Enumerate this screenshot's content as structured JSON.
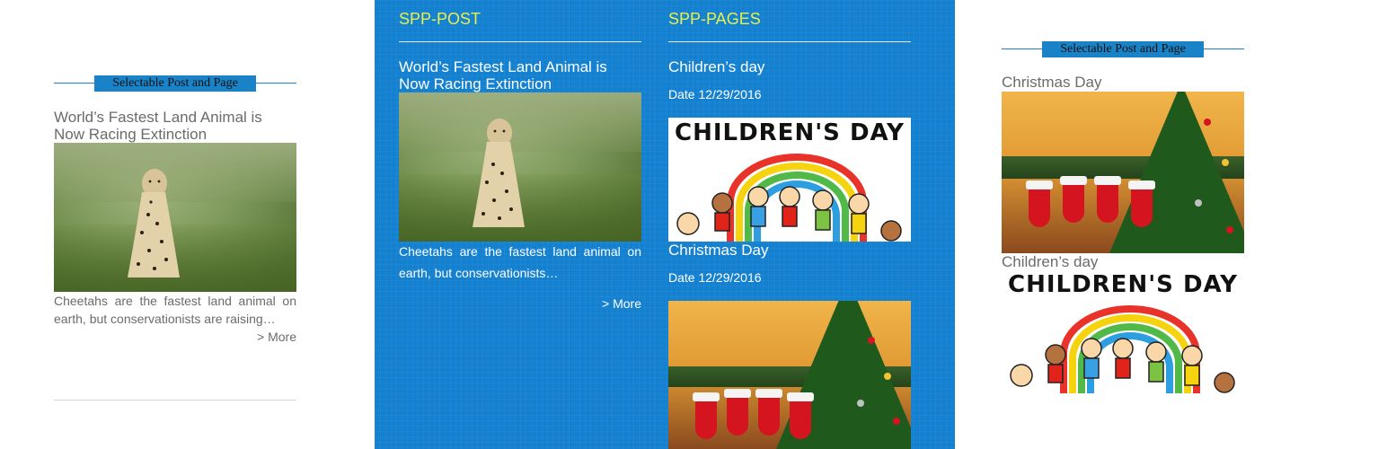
{
  "left_widget": {
    "heading": "Selectable Post and Page",
    "post_title": "World’s Fastest Land Animal is Now Racing Extinction",
    "excerpt": "Cheetahs are the fastest land animal on earth, but conservationists are raising…",
    "more": "> More"
  },
  "blue_panel": {
    "posts": {
      "heading": "SPP-POST",
      "title": "World’s Fastest Land Animal is Now Racing Extinction",
      "excerpt": "Cheetahs are the fastest land animal on earth, but conservationists…",
      "more": "> More"
    },
    "pages": {
      "heading": "SPP-PAGES",
      "items": [
        {
          "title": "Children’s day",
          "date": "Date 12/29/2016",
          "image_text": "CHILDREN'S DAY"
        },
        {
          "title": "Christmas Day",
          "date": "Date 12/29/2016"
        }
      ]
    }
  },
  "right_widget": {
    "heading": "Selectable Post and Page",
    "items": [
      {
        "title": "Christmas Day"
      },
      {
        "title": "Children’s day",
        "image_text": "CHILDREN'S DAY"
      }
    ]
  },
  "colors": {
    "accent_blue": "#1380d0",
    "heading_yellow": "#e8f04a",
    "grey_text": "#6b6b6b"
  }
}
